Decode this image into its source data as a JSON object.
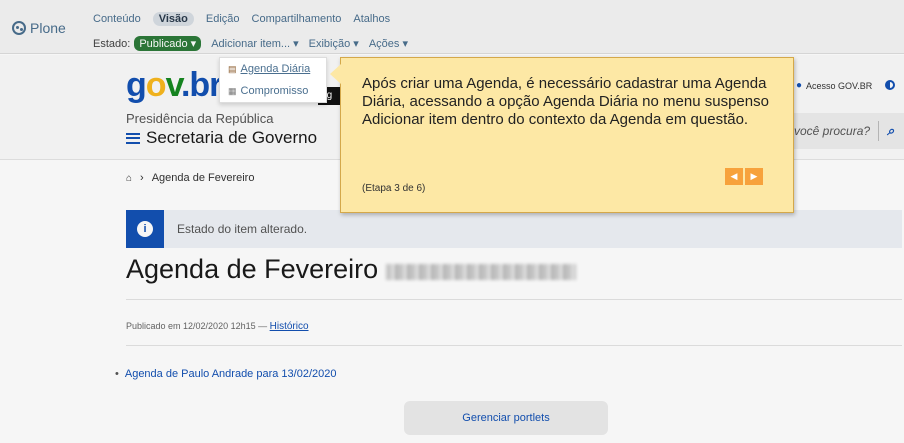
{
  "toolbar": {
    "logo": "Plone",
    "tabs": [
      "Conteúdo",
      "Visão",
      "Edição",
      "Compartilhamento",
      "Atalhos"
    ],
    "state_label": "Estado:",
    "state_value": "Publicado ▾",
    "add_item": "Adicionar item... ▾",
    "display": "Exibição ▾",
    "actions": "Ações ▾"
  },
  "header": {
    "logo_g": "g",
    "logo_o": "o",
    "logo_v": "v",
    "logo_br": ".br",
    "presidencia": "Presidência da República",
    "secretaria": "Secretaria de Governo",
    "acesso": "Acesso GOV.BR",
    "search_placeholder": "você procura?"
  },
  "dropdown": {
    "items": [
      "Agenda Diária",
      "Compromisso"
    ],
    "tooltip_fragment": "Ag"
  },
  "breadcrumb": {
    "current": "Agenda de Fevereiro"
  },
  "alert": {
    "text": "Estado do item alterado."
  },
  "page": {
    "title": "Agenda de Fevereiro",
    "published": "Publicado em 12/02/2020 12h15 —",
    "history_link": "Histórico",
    "list_item": "Agenda de Paulo Andrade para 13/02/2020",
    "portlets_button": "Gerenciar portlets"
  },
  "tour": {
    "text": "Após criar uma Agenda, é necessário cadastrar uma Agenda Diária, acessando a opção Agenda Diária no menu suspenso Adicionar item dentro do contexto da Agenda em questão.",
    "step": "(Etapa 3 de 6)",
    "prev": "◀",
    "next": "▶"
  },
  "colors": {
    "gov_blue": "#1351b4",
    "tour_bg": "#fde8a5",
    "nav_orange": "#f7a23c",
    "status_green": "#2d7a3a"
  }
}
